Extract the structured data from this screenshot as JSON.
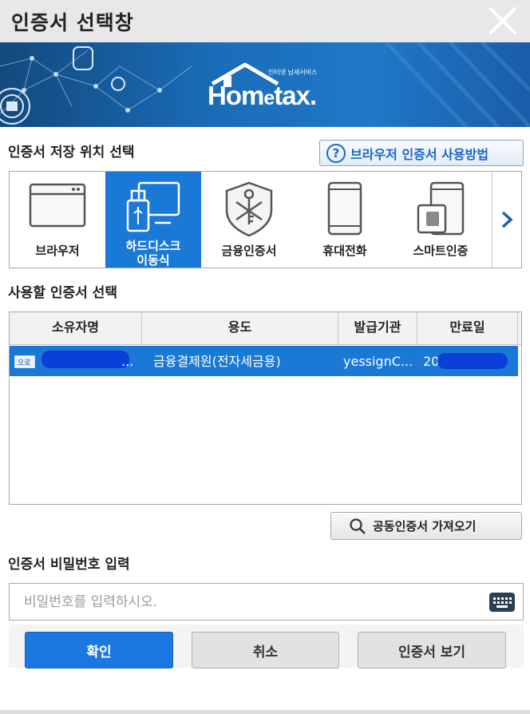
{
  "window": {
    "title": "인증서 선택창"
  },
  "banner": {
    "logo_text": "Hometax",
    "logo_sub": "인터넷 납세서비스"
  },
  "storage": {
    "label": "인증서 저장 위치 선택",
    "help_label": "브라우저 인증서 사용방법",
    "items": [
      {
        "label": "브라우저",
        "icon": "browser-icon"
      },
      {
        "label": "하드디스크\n이동식",
        "icon": "usb-drive-icon",
        "selected": true
      },
      {
        "label": "금융인증서",
        "icon": "key-shield-icon"
      },
      {
        "label": "휴대전화",
        "icon": "phone-icon"
      },
      {
        "label": "스마트인증",
        "icon": "smart-card-phone-icon"
      }
    ]
  },
  "cert_list": {
    "label": "사용할 인증서 선택",
    "columns": [
      "소유자명",
      "용도",
      "발급기관",
      "만료일"
    ],
    "rows": [
      {
        "owner": "...",
        "usage": "금융결제원(전자세금용)",
        "issuer": "yessignC...",
        "expiry": "20"
      }
    ]
  },
  "import_label": "공동인증서 가져오기",
  "password": {
    "label": "인증서 비밀번호 입력",
    "placeholder": "비밀번호를 입력하시오."
  },
  "buttons": {
    "ok": "확인",
    "cancel": "취소",
    "view": "인증서 보기"
  },
  "colors": {
    "accent": "#1a78d6",
    "banner": "#1a6cb8"
  }
}
